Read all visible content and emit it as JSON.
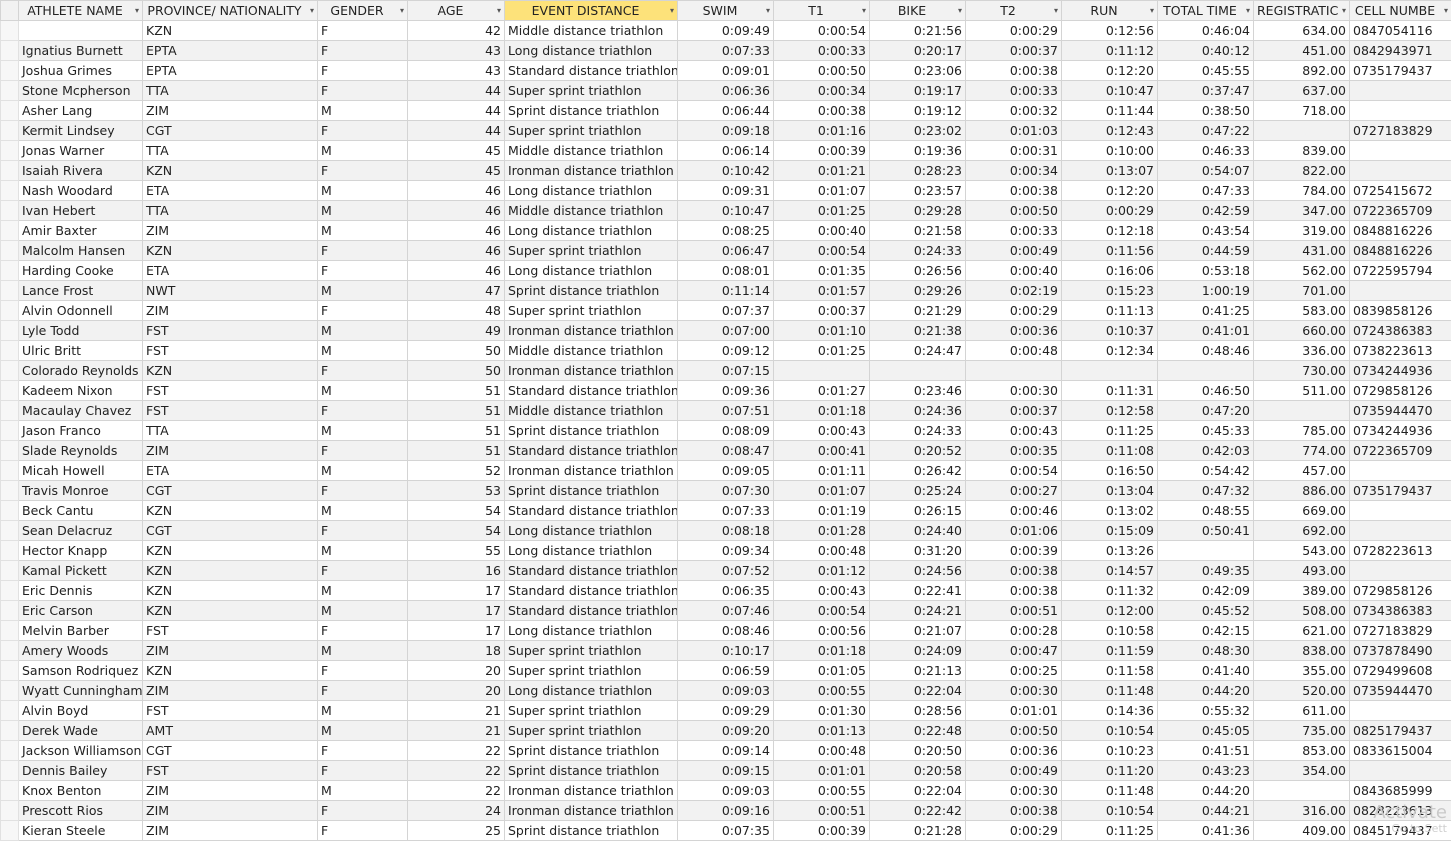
{
  "columns": [
    "ATHLETE NAME",
    "PROVINCE/ NATIONALITY",
    "GENDER",
    "AGE",
    "EVENT DISTANCE",
    "SWIM",
    "T1",
    "BIKE",
    "T2",
    "RUN",
    "TOTAL TIME",
    "REGISTRATIC",
    "CELL NUMBE"
  ],
  "filter_icon": "dropdown-arrow-icon",
  "active_column": "EVENT DISTANCE",
  "colors": {
    "header_bg": "#f2f2f2",
    "active_header_bg": "#fde27a",
    "alt_row_bg": "#f2f2f2",
    "grid": "#d4d4d4"
  },
  "rows": [
    [
      "",
      "KZN",
      "F",
      "42",
      "Middle distance triathlon",
      "0:09:49",
      "0:00:54",
      "0:21:56",
      "0:00:29",
      "0:12:56",
      "0:46:04",
      "634.00",
      "0847054116"
    ],
    [
      "Ignatius Burnett",
      "EPTA",
      "F",
      "43",
      "Long distance triathlon",
      "0:07:33",
      "0:00:33",
      "0:20:17",
      "0:00:37",
      "0:11:12",
      "0:40:12",
      "451.00",
      "0842943971"
    ],
    [
      "Joshua Grimes",
      "EPTA",
      "F",
      "43",
      "Standard distance triathlon",
      "0:09:01",
      "0:00:50",
      "0:23:06",
      "0:00:38",
      "0:12:20",
      "0:45:55",
      "892.00",
      "0735179437"
    ],
    [
      "Stone Mcpherson",
      "TTA",
      "F",
      "44",
      "Super sprint triathlon",
      "0:06:36",
      "0:00:34",
      "0:19:17",
      "0:00:33",
      "0:10:47",
      "0:37:47",
      "637.00",
      ""
    ],
    [
      "Asher Lang",
      "ZIM",
      "M",
      "44",
      "Sprint distance triathlon",
      "0:06:44",
      "0:00:38",
      "0:19:12",
      "0:00:32",
      "0:11:44",
      "0:38:50",
      "718.00",
      ""
    ],
    [
      "Kermit Lindsey",
      "CGT",
      "F",
      "44",
      "Super sprint triathlon",
      "0:09:18",
      "0:01:16",
      "0:23:02",
      "0:01:03",
      "0:12:43",
      "0:47:22",
      "",
      "0727183829"
    ],
    [
      "Jonas Warner",
      "TTA",
      "M",
      "45",
      "Middle distance triathlon",
      "0:06:14",
      "0:00:39",
      "0:19:36",
      "0:00:31",
      "0:10:00",
      "0:46:33",
      "839.00",
      ""
    ],
    [
      "Isaiah Rivera",
      "KZN",
      "F",
      "45",
      "Ironman distance triathlon",
      "0:10:42",
      "0:01:21",
      "0:28:23",
      "0:00:34",
      "0:13:07",
      "0:54:07",
      "822.00",
      ""
    ],
    [
      "Nash Woodard",
      "ETA",
      "M",
      "46",
      "Long distance triathlon",
      "0:09:31",
      "0:01:07",
      "0:23:57",
      "0:00:38",
      "0:12:20",
      "0:47:33",
      "784.00",
      "0725415672"
    ],
    [
      "Ivan Hebert",
      "TTA",
      "M",
      "46",
      "Middle distance triathlon",
      "0:10:47",
      "0:01:25",
      "0:29:28",
      "0:00:50",
      "0:00:29",
      "0:42:59",
      "347.00",
      "0722365709"
    ],
    [
      "Amir Baxter",
      "ZIM",
      "M",
      "46",
      "Long distance triathlon",
      "0:08:25",
      "0:00:40",
      "0:21:58",
      "0:00:33",
      "0:12:18",
      "0:43:54",
      "319.00",
      "0848816226"
    ],
    [
      "Malcolm Hansen",
      "KZN",
      "F",
      "46",
      "Super sprint triathlon",
      "0:06:47",
      "0:00:54",
      "0:24:33",
      "0:00:49",
      "0:11:56",
      "0:44:59",
      "431.00",
      "0848816226"
    ],
    [
      "Harding Cooke",
      "ETA",
      "F",
      "46",
      "Long distance triathlon",
      "0:08:01",
      "0:01:35",
      "0:26:56",
      "0:00:40",
      "0:16:06",
      "0:53:18",
      "562.00",
      "0722595794"
    ],
    [
      "Lance Frost",
      "NWT",
      "M",
      "47",
      "Sprint distance triathlon",
      "0:11:14",
      "0:01:57",
      "0:29:26",
      "0:02:19",
      "0:15:23",
      "1:00:19",
      "701.00",
      ""
    ],
    [
      "Alvin Odonnell",
      "ZIM",
      "F",
      "48",
      "Super sprint triathlon",
      "0:07:37",
      "0:00:37",
      "0:21:29",
      "0:00:29",
      "0:11:13",
      "0:41:25",
      "583.00",
      "0839858126"
    ],
    [
      "Lyle Todd",
      "FST",
      "M",
      "49",
      "Ironman distance triathlon",
      "0:07:00",
      "0:01:10",
      "0:21:38",
      "0:00:36",
      "0:10:37",
      "0:41:01",
      "660.00",
      "0724386383"
    ],
    [
      "Ulric Britt",
      "FST",
      "M",
      "50",
      "Middle distance triathlon",
      "0:09:12",
      "0:01:25",
      "0:24:47",
      "0:00:48",
      "0:12:34",
      "0:48:46",
      "336.00",
      "0738223613"
    ],
    [
      "Colorado Reynolds",
      "KZN",
      "F",
      "50",
      "Ironman distance triathlon",
      "0:07:15",
      "",
      "",
      "",
      "",
      "",
      "730.00",
      "0734244936"
    ],
    [
      "Kadeem Nixon",
      "FST",
      "M",
      "51",
      "Standard distance triathlon",
      "0:09:36",
      "0:01:27",
      "0:23:46",
      "0:00:30",
      "0:11:31",
      "0:46:50",
      "511.00",
      "0729858126"
    ],
    [
      "Macaulay Chavez",
      "FST",
      "F",
      "51",
      "Middle distance triathlon",
      "0:07:51",
      "0:01:18",
      "0:24:36",
      "0:00:37",
      "0:12:58",
      "0:47:20",
      "",
      "0735944470"
    ],
    [
      "Jason Franco",
      "TTA",
      "M",
      "51",
      "Sprint distance triathlon",
      "0:08:09",
      "0:00:43",
      "0:24:33",
      "0:00:43",
      "0:11:25",
      "0:45:33",
      "785.00",
      "0734244936"
    ],
    [
      "Slade Reynolds",
      "ZIM",
      "F",
      "51",
      "Standard distance triathlon",
      "0:08:47",
      "0:00:41",
      "0:20:52",
      "0:00:35",
      "0:11:08",
      "0:42:03",
      "774.00",
      "0722365709"
    ],
    [
      "Micah Howell",
      "ETA",
      "M",
      "52",
      "Ironman distance triathlon",
      "0:09:05",
      "0:01:11",
      "0:26:42",
      "0:00:54",
      "0:16:50",
      "0:54:42",
      "457.00",
      ""
    ],
    [
      "Travis Monroe",
      "CGT",
      "F",
      "53",
      "Sprint distance triathlon",
      "0:07:30",
      "0:01:07",
      "0:25:24",
      "0:00:27",
      "0:13:04",
      "0:47:32",
      "886.00",
      "0735179437"
    ],
    [
      "Beck Cantu",
      "KZN",
      "M",
      "54",
      "Standard distance triathlon",
      "0:07:33",
      "0:01:19",
      "0:26:15",
      "0:00:46",
      "0:13:02",
      "0:48:55",
      "669.00",
      ""
    ],
    [
      "Sean Delacruz",
      "CGT",
      "F",
      "54",
      "Long distance triathlon",
      "0:08:18",
      "0:01:28",
      "0:24:40",
      "0:01:06",
      "0:15:09",
      "0:50:41",
      "692.00",
      ""
    ],
    [
      "Hector Knapp",
      "KZN",
      "M",
      "55",
      "Long distance triathlon",
      "0:09:34",
      "0:00:48",
      "0:31:20",
      "0:00:39",
      "0:13:26",
      "",
      "543.00",
      "0728223613"
    ],
    [
      "Kamal Pickett",
      "KZN",
      "F",
      "16",
      "Standard distance triathlon",
      "0:07:52",
      "0:01:12",
      "0:24:56",
      "0:00:38",
      "0:14:57",
      "0:49:35",
      "493.00",
      ""
    ],
    [
      "Eric Dennis",
      "KZN",
      "M",
      "17",
      "Standard distance triathlon",
      "0:06:35",
      "0:00:43",
      "0:22:41",
      "0:00:38",
      "0:11:32",
      "0:42:09",
      "389.00",
      "0729858126"
    ],
    [
      "Eric Carson",
      "KZN",
      "M",
      "17",
      "Standard distance triathlon",
      "0:07:46",
      "0:00:54",
      "0:24:21",
      "0:00:51",
      "0:12:00",
      "0:45:52",
      "508.00",
      "0734386383"
    ],
    [
      "Melvin Barber",
      "FST",
      "F",
      "17",
      "Long distance triathlon",
      "0:08:46",
      "0:00:56",
      "0:21:07",
      "0:00:28",
      "0:10:58",
      "0:42:15",
      "621.00",
      "0727183829"
    ],
    [
      "Amery Woods",
      "ZIM",
      "M",
      "18",
      "Super sprint triathlon",
      "0:10:17",
      "0:01:18",
      "0:24:09",
      "0:00:47",
      "0:11:59",
      "0:48:30",
      "838.00",
      "0737878490"
    ],
    [
      "Samson Rodriquez",
      "KZN",
      "F",
      "20",
      "Super sprint triathlon",
      "0:06:59",
      "0:01:05",
      "0:21:13",
      "0:00:25",
      "0:11:58",
      "0:41:40",
      "355.00",
      "0729499608"
    ],
    [
      "Wyatt Cunningham",
      "ZIM",
      "F",
      "20",
      "Long distance triathlon",
      "0:09:03",
      "0:00:55",
      "0:22:04",
      "0:00:30",
      "0:11:48",
      "0:44:20",
      "520.00",
      "0735944470"
    ],
    [
      "Alvin Boyd",
      "FST",
      "M",
      "21",
      "Super sprint triathlon",
      "0:09:29",
      "0:01:30",
      "0:28:56",
      "0:01:01",
      "0:14:36",
      "0:55:32",
      "611.00",
      ""
    ],
    [
      "Derek Wade",
      "AMT",
      "M",
      "21",
      "Super sprint triathlon",
      "0:09:20",
      "0:01:13",
      "0:22:48",
      "0:00:50",
      "0:10:54",
      "0:45:05",
      "735.00",
      "0825179437"
    ],
    [
      "Jackson Williamson",
      "CGT",
      "F",
      "22",
      "Sprint distance triathlon",
      "0:09:14",
      "0:00:48",
      "0:20:50",
      "0:00:36",
      "0:10:23",
      "0:41:51",
      "853.00",
      "0833615004"
    ],
    [
      "Dennis Bailey",
      "FST",
      "F",
      "22",
      "Sprint distance triathlon",
      "0:09:15",
      "0:01:01",
      "0:20:58",
      "0:00:49",
      "0:11:20",
      "0:43:23",
      "354.00",
      ""
    ],
    [
      "Knox Benton",
      "ZIM",
      "M",
      "22",
      "Ironman distance triathlon",
      "0:09:03",
      "0:00:55",
      "0:22:04",
      "0:00:30",
      "0:11:48",
      "0:44:20",
      "",
      "0843685999"
    ],
    [
      "Prescott Rios",
      "ZIM",
      "F",
      "24",
      "Ironman distance triathlon",
      "0:09:16",
      "0:00:51",
      "0:22:42",
      "0:00:38",
      "0:10:54",
      "0:44:21",
      "316.00",
      "0828223613"
    ],
    [
      "Kieran Steele",
      "ZIM",
      "F",
      "25",
      "Sprint distance triathlon",
      "0:07:35",
      "0:00:39",
      "0:21:28",
      "0:00:29",
      "0:11:25",
      "0:41:36",
      "409.00",
      "0845179437"
    ]
  ],
  "watermark": {
    "title": "Activate",
    "subtitle": "Go to Sett"
  }
}
